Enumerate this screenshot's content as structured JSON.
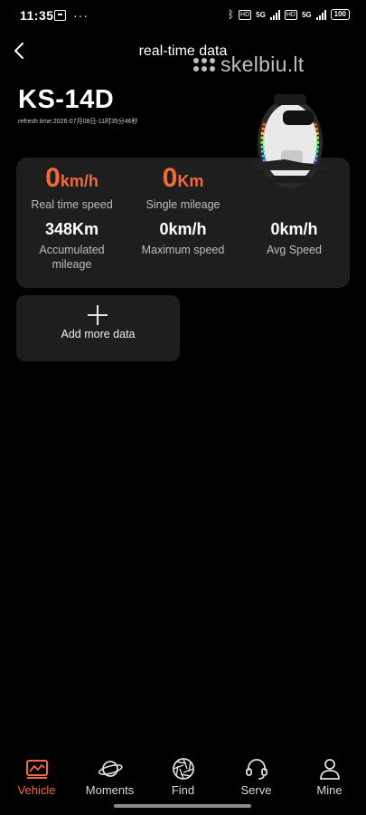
{
  "status_bar": {
    "time": "11:35",
    "network_1": "5G",
    "network_2": "5G",
    "battery": "100"
  },
  "header": {
    "title": "real-time data",
    "watermark": "skelbiu.lt"
  },
  "device": {
    "name": "KS-14D",
    "refresh_time": "refresh time:2026-07月08日-11时35分46秒"
  },
  "metrics": {
    "real_time_speed": {
      "value": "0",
      "unit": "km/h",
      "label": "Real time speed"
    },
    "single_mileage": {
      "value": "0",
      "unit": "Km",
      "label": "Single mileage"
    },
    "accumulated_mileage": {
      "value": "348Km",
      "label_line1": "Accumulated",
      "label_line2": "mileage"
    },
    "maximum_speed": {
      "value": "0km/h",
      "label": "Maximum speed"
    },
    "avg_speed": {
      "value": "0km/h",
      "label": "Avg Speed"
    }
  },
  "add_more": {
    "label": "Add more data"
  },
  "nav": {
    "items": [
      {
        "label": "Vehicle",
        "icon": "vehicle-icon",
        "active": true
      },
      {
        "label": "Moments",
        "icon": "planet-icon",
        "active": false
      },
      {
        "label": "Find",
        "icon": "aperture-icon",
        "active": false
      },
      {
        "label": "Serve",
        "icon": "headset-icon",
        "active": false
      },
      {
        "label": "Mine",
        "icon": "user-icon",
        "active": false
      }
    ]
  },
  "colors": {
    "accent": "#f06a3b",
    "card": "#1e1e1e",
    "background": "#000000"
  }
}
